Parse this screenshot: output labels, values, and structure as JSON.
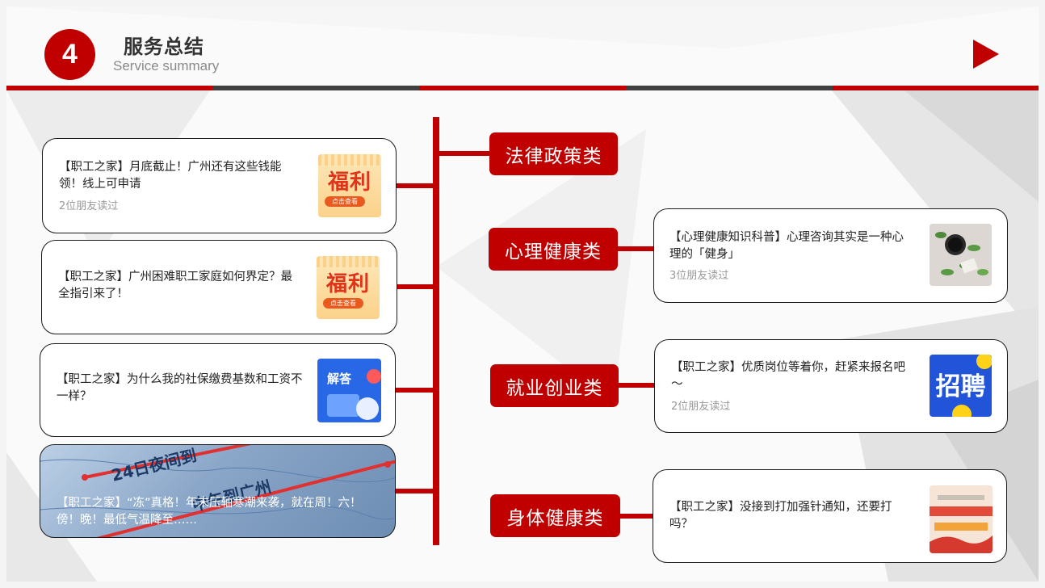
{
  "header": {
    "number": "4",
    "title": "服务总结",
    "subtitle": "Service summary"
  },
  "categories": [
    {
      "label": "法律政策类"
    },
    {
      "label": "心理健康类"
    },
    {
      "label": "就业创业类"
    },
    {
      "label": "身体健康类"
    }
  ],
  "left_articles": [
    {
      "title": "【职工之家】月底截止！广州还有这些钱能领！线上可申请",
      "meta": "2位朋友读过",
      "thumb_text": "福利",
      "thumb_btn": "点击查看"
    },
    {
      "title": "【职工之家】广州困难职工家庭如何界定？最全指引来了！",
      "meta": "",
      "thumb_text": "福利",
      "thumb_btn": "点击查看"
    },
    {
      "title": "【职工之家】为什么我的社保缴费基数和工资不一样？",
      "meta": "",
      "thumb_text": "解答"
    },
    {
      "title": "【职工之家】“冻”真格！年末压轴寒潮来袭，就在周！六！傍！晚！最低气温降至……",
      "meta": "",
      "photo_text": "24日夜间到",
      "photo_text2": "中午到广州"
    }
  ],
  "right_articles": [
    {
      "title": "【心理健康知识科普】心理咨询其实是一种心理的「健身」",
      "meta": "3位朋友读过"
    },
    {
      "title": "【职工之家】优质岗位等着你，赶紧来报名吧～",
      "meta": "2位朋友读过",
      "thumb_text": "招聘"
    },
    {
      "title": "【职工之家】没接到打加强针通知，还要打吗？",
      "meta": ""
    }
  ],
  "colors": {
    "accent": "#c00000",
    "dark": "#404040"
  }
}
